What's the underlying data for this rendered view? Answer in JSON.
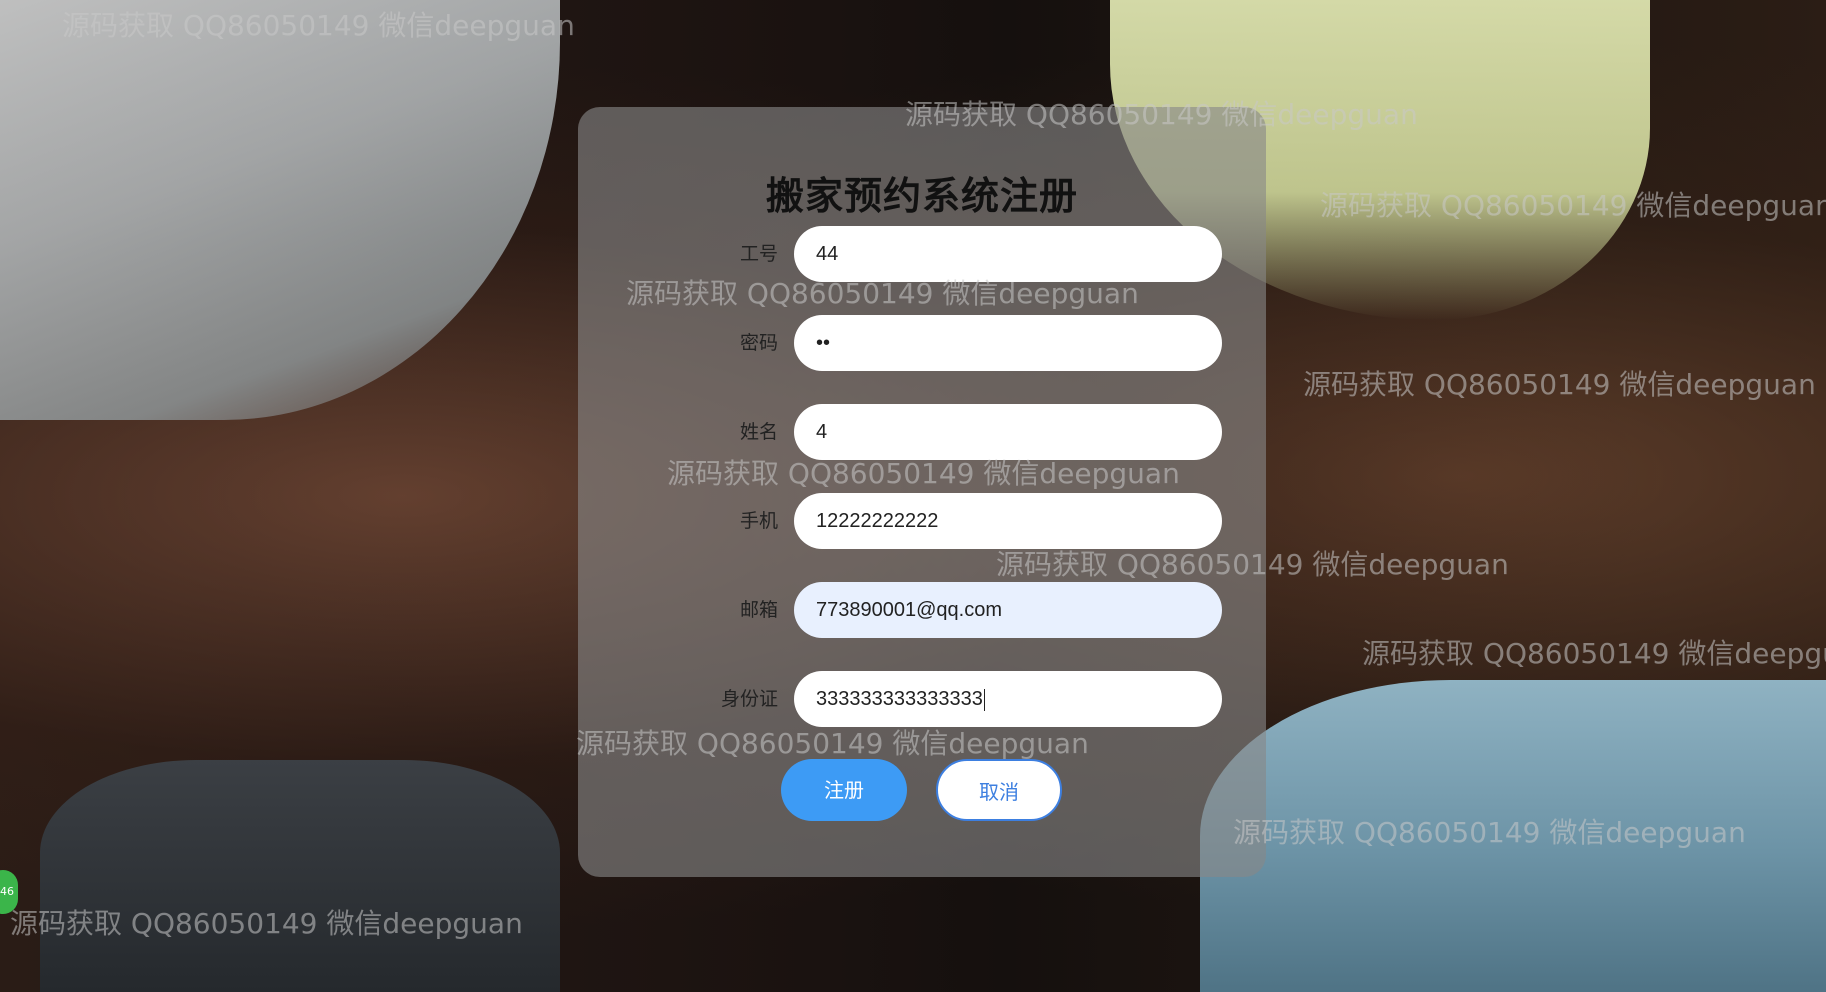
{
  "form": {
    "title": "搬家预约系统注册",
    "fields": [
      {
        "label": "工号",
        "value": "44"
      },
      {
        "label": "密码",
        "value": "••"
      },
      {
        "label": "姓名",
        "value": "4"
      },
      {
        "label": "手机",
        "value": "12222222222"
      },
      {
        "label": "邮箱",
        "value": "773890001@qq.com"
      },
      {
        "label": "身份证",
        "value": "333333333333333"
      }
    ],
    "register_label": "注册",
    "cancel_label": "取消"
  },
  "watermark_text": "源码获取 QQ86050149 微信deepguan",
  "badge_text": "46",
  "colors": {
    "accent": "#3d9bf5",
    "card": "#878787",
    "autofill": "#e8f0fe"
  }
}
